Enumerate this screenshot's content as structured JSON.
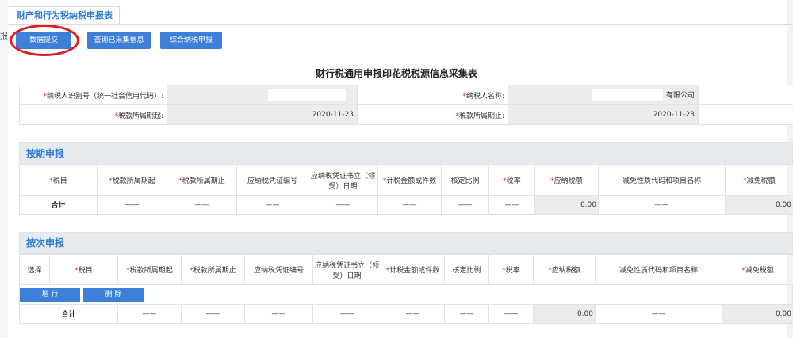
{
  "tab": {
    "label": "财产和行为税纳税申报表"
  },
  "side_char": "报",
  "toolbar": {
    "submit": "数据提交",
    "query": "查询已采集信息",
    "comprehensive": "综合纳税申报"
  },
  "form_title": "财行税通用申报印花税税源信息采集表",
  "info": {
    "taxpayer_id_label": "纳税人识别号（统一社会信用代码）:",
    "taxpayer_name_label": "纳税人名称:",
    "taxpayer_name_value": "有限公司",
    "period_start_label": "税款所属期起:",
    "period_start_value": "2020-11-23",
    "period_end_label": "税款所属期止:",
    "period_end_value": "2020-11-23"
  },
  "periodic": {
    "title": "按期申报",
    "headers": [
      "税目",
      "税款所属期起",
      "税款所属期止",
      "应纳税凭证编号",
      "应纳税凭证书立（领受）日期",
      "计税金额或件数",
      "核定比例",
      "税率",
      "应纳税额",
      "减免性质代码和项目名称",
      "减免税额"
    ],
    "required": [
      "*",
      "*",
      "*",
      "",
      "",
      "*",
      "",
      "*",
      "*",
      "",
      "*"
    ],
    "total_label": "合计",
    "dash": "——",
    "tax_total": "0.00",
    "relief_total": "0.00"
  },
  "per_item": {
    "title": "按次申报",
    "select_label": "选择",
    "headers": [
      "税目",
      "税款所属期起",
      "税款所属期止",
      "应纳税凭证编号",
      "应纳税凭证书立（领受）日期",
      "计税金额或件数",
      "核定比例",
      "税率",
      "应纳税额",
      "减免性质代码和项目名称",
      "减免税额"
    ],
    "required": [
      "*",
      "*",
      "*",
      "",
      "",
      "*",
      "",
      "*",
      "*",
      "",
      "*"
    ],
    "add_row": "增 行",
    "delete": "删 除",
    "total_label": "合计",
    "dash": "——",
    "tax_total": "0.00",
    "relief_total": "0.00"
  },
  "colors": {
    "accent": "#3d7fd9",
    "highlight": "#e21b22",
    "section_bg": "#e7ebf0"
  }
}
